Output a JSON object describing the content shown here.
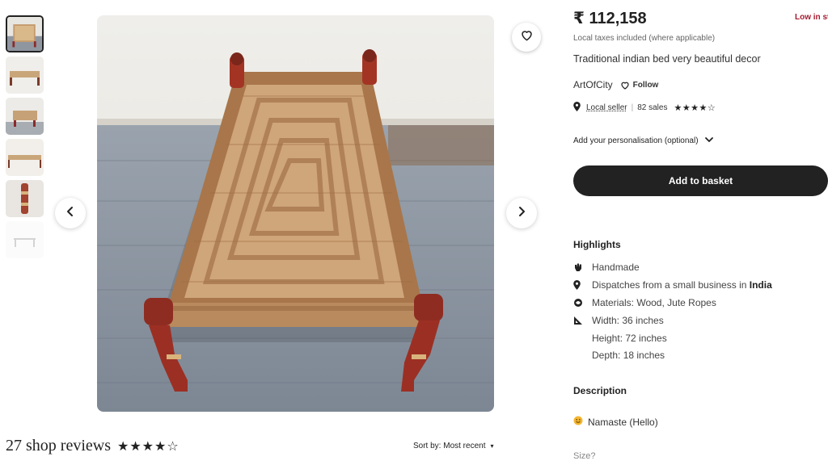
{
  "gallery": {
    "thumbnails": [
      "thumb-1",
      "thumb-2",
      "thumb-3",
      "thumb-4",
      "thumb-5",
      "thumb-6"
    ],
    "prev_icon": "chevron-left-icon",
    "next_icon": "chevron-right-icon",
    "favorite_icon": "heart-icon"
  },
  "reviews": {
    "count_label": "27 shop reviews",
    "stars": "★★★★☆",
    "sort_label": "Sort by: Most recent",
    "sort_caret": "▾"
  },
  "product": {
    "price": "₹ 112,158",
    "stock_note": "Low in stock",
    "taxes_note": "Local taxes included (where applicable)",
    "title": "Traditional indian bed very beautiful decor"
  },
  "shop": {
    "name": "ArtOfCity",
    "follow_label": "Follow",
    "local_seller": "Local seller",
    "sales": "82 sales",
    "stars": "★★★★☆"
  },
  "personalisation": {
    "label": "Add your personalisation (optional)"
  },
  "basket": {
    "label": "Add to basket"
  },
  "highlights": {
    "heading": "Highlights",
    "handmade": "Handmade",
    "dispatch_prefix": "Dispatches from a small business in ",
    "dispatch_country": "India",
    "materials": "Materials: Wood, Jute Ropes",
    "width": "Width: 36 inches",
    "height": "Height: 72 inches",
    "depth": "Depth: 18 inches"
  },
  "description": {
    "heading": "Description",
    "text": "Namaste (Hello)"
  },
  "size": {
    "label": "Size?"
  },
  "colors": {
    "primary_button": "#222222",
    "stock_red": "#a61a2e",
    "muted_text": "#666666"
  }
}
